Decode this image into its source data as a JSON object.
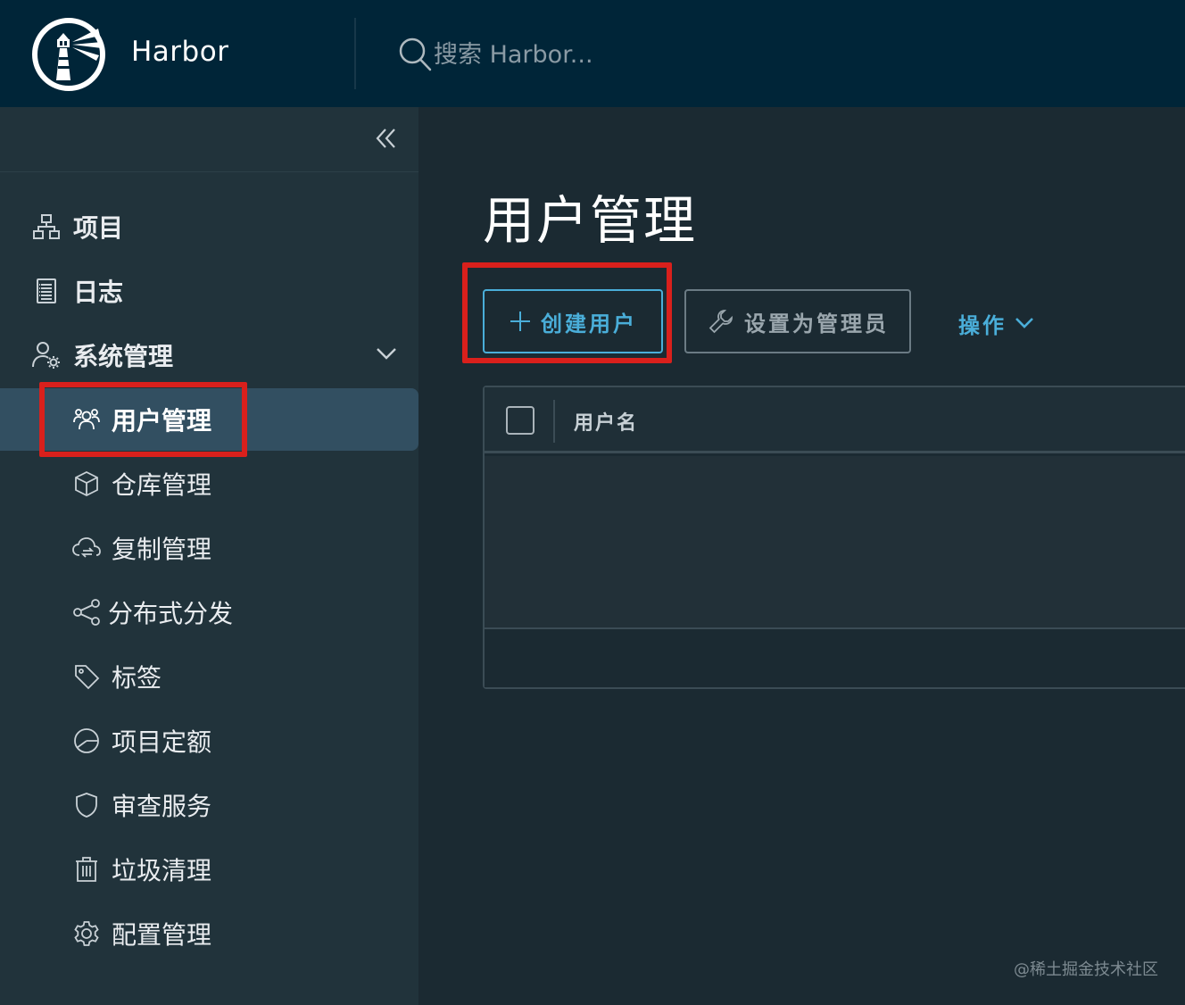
{
  "header": {
    "brand": "Harbor",
    "search_placeholder": "搜索 Harbor...",
    "logo_icon": "harbor-lighthouse-logo",
    "bg_color": "#002538"
  },
  "sidebar": {
    "collapse_icon": "double-chevron-left-icon",
    "top_items": [
      {
        "label": "项目",
        "icon": "projects-icon"
      },
      {
        "label": "日志",
        "icon": "logs-icon"
      },
      {
        "label": "系统管理",
        "icon": "admin-settings-icon",
        "expanded": true
      }
    ],
    "sub_items": [
      {
        "label": "用户管理",
        "icon": "users-icon",
        "active": true
      },
      {
        "label": "仓库管理",
        "icon": "box-icon"
      },
      {
        "label": "复制管理",
        "icon": "cloud-sync-icon"
      },
      {
        "label": "分布式分发",
        "icon": "share-icon"
      },
      {
        "label": "标签",
        "icon": "tag-icon"
      },
      {
        "label": "项目定额",
        "icon": "quota-icon"
      },
      {
        "label": "审查服务",
        "icon": "shield-icon"
      },
      {
        "label": "垃圾清理",
        "icon": "trash-icon"
      },
      {
        "label": "配置管理",
        "icon": "gear-icon"
      }
    ]
  },
  "main": {
    "title": "用户管理",
    "create_user_label": "创建用户",
    "set_admin_label": "设置为管理员",
    "actions_label": "操作",
    "table": {
      "columns": [
        "用户名"
      ],
      "rows": []
    },
    "accent_color": "#4aaed9",
    "highlight_color": "#d9201c"
  },
  "watermark": "@稀土掘金技术社区"
}
